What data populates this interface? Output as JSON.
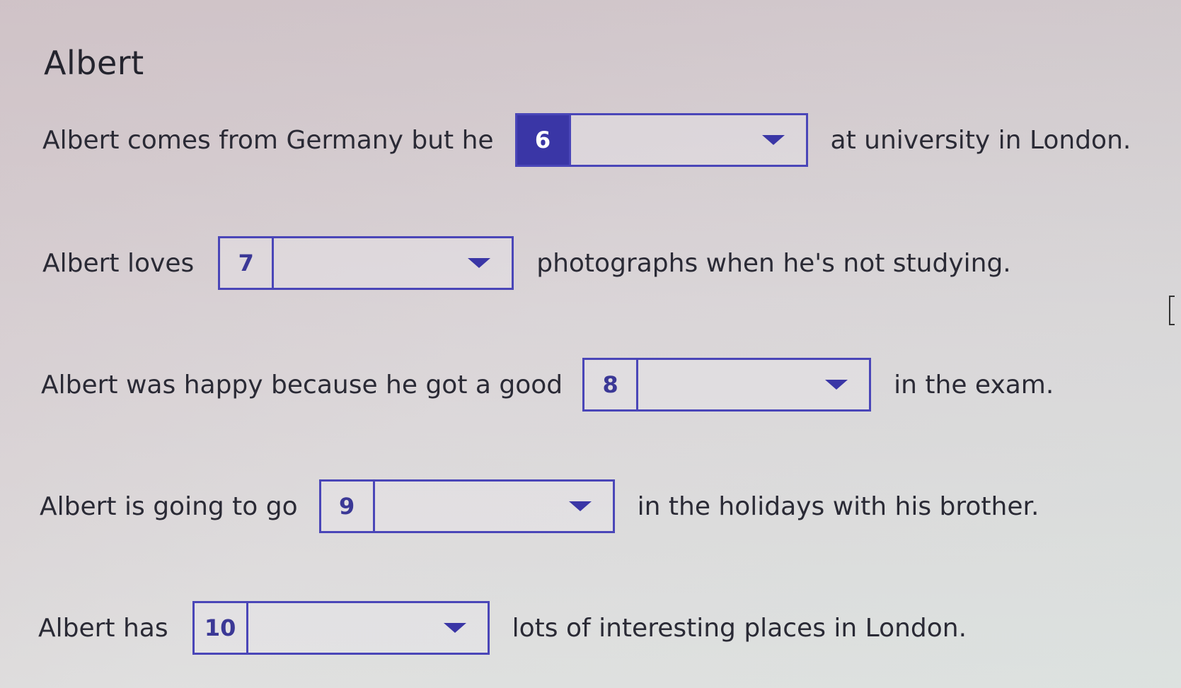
{
  "title": "Albert",
  "questions": [
    {
      "before": "Albert comes from Germany but he",
      "number": "6",
      "value": "",
      "after": "at university in London.",
      "active": true
    },
    {
      "before": "Albert loves",
      "number": "7",
      "value": "",
      "after": "photographs when he's not studying.",
      "active": false
    },
    {
      "before": "Albert was happy because he got a good",
      "number": "8",
      "value": "",
      "after": "in the exam.",
      "active": false
    },
    {
      "before": "Albert is going to go",
      "number": "9",
      "value": "",
      "after": "in the holidays with his brother.",
      "active": false
    },
    {
      "before": "Albert has",
      "number": "10",
      "value": "",
      "after": "lots of interesting places in London.",
      "active": false
    }
  ],
  "colors": {
    "accent": "#3a36a6",
    "border": "#4a46b8",
    "text": "#2a2a35"
  },
  "icons": {
    "dropdown": "chevron-down-icon"
  }
}
